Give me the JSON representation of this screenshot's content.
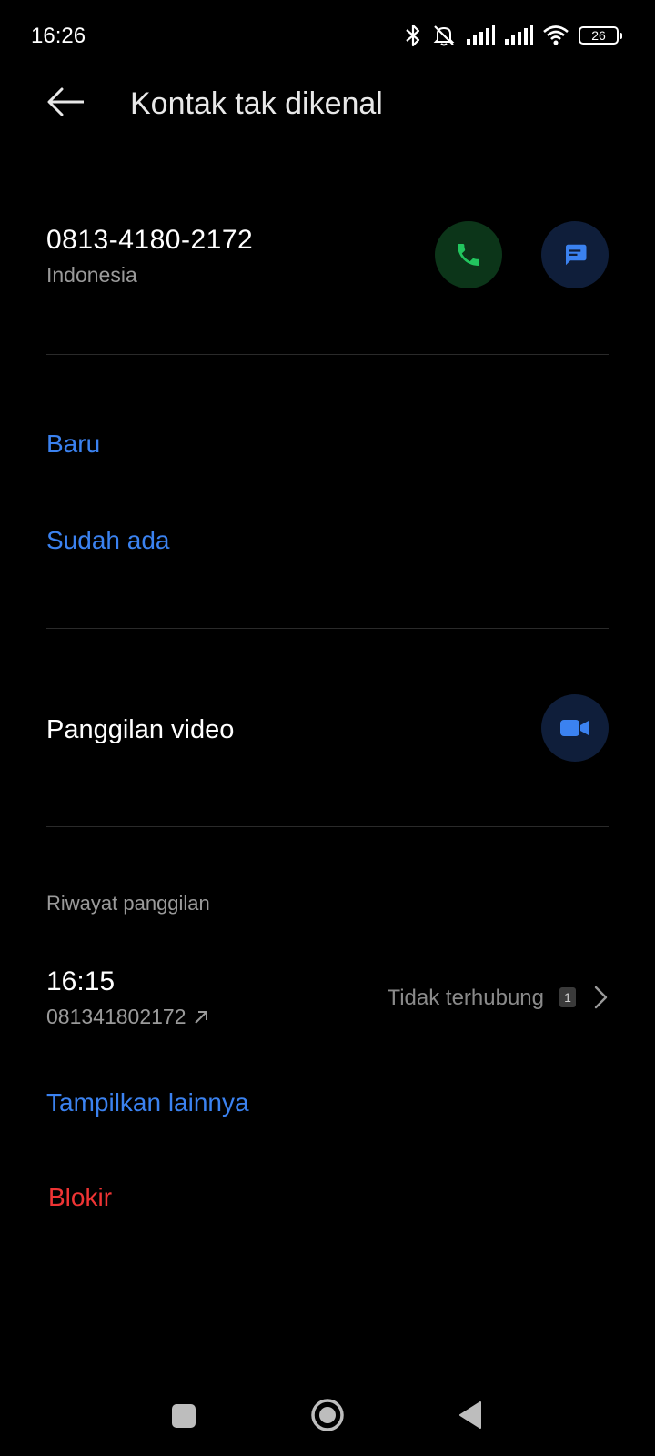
{
  "status_bar": {
    "time": "16:26",
    "battery": "26",
    "icons": [
      "bluetooth-icon",
      "mute-icon",
      "signal-icon",
      "signal-icon",
      "wifi-icon",
      "battery-icon"
    ]
  },
  "header": {
    "title": "Kontak tak dikenal",
    "back_icon": "arrow-left-icon"
  },
  "contact": {
    "number": "0813-4180-2172",
    "country": "Indonesia",
    "call_color": "#22c55e",
    "message_color": "#3b82f0"
  },
  "add_contact": {
    "new_label": "Baru",
    "existing_label": "Sudah ada"
  },
  "video": {
    "label": "Panggilan video",
    "icon": "video-camera-icon"
  },
  "call_history": {
    "heading": "Riwayat panggilan",
    "entries": [
      {
        "time": "16:15",
        "number": "081341802172",
        "status": "Tidak terhubung",
        "count": "1",
        "direction_icon": "outgoing-arrow-icon"
      }
    ],
    "show_more_label": "Tampilkan lainnya"
  },
  "block": {
    "label": "Blokir",
    "color": "#ee3434"
  },
  "nav_bar": {
    "icons": [
      "recents-square-icon",
      "home-circle-icon",
      "back-triangle-icon"
    ]
  }
}
